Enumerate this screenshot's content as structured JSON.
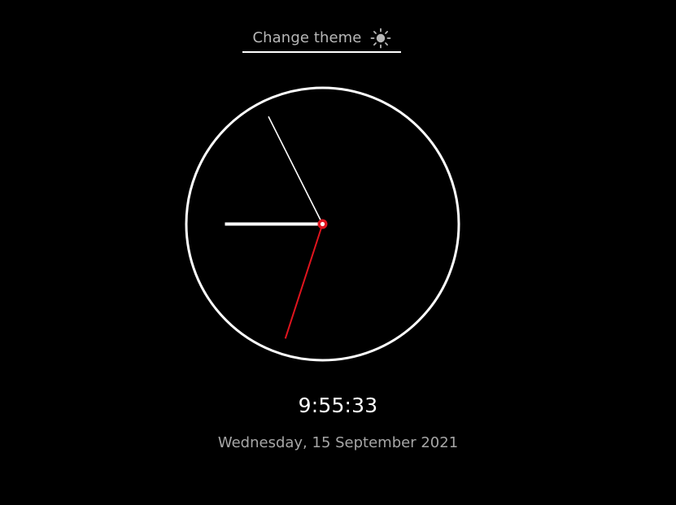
{
  "theme_toggle": {
    "label": "Change theme",
    "icon": "sun-icon"
  },
  "clock": {
    "hours": 9,
    "minutes": 55,
    "seconds": 33,
    "colors": {
      "face_border": "#ffffff",
      "hour_hand": "#ffffff",
      "minute_hand": "#ffffff",
      "second_hand": "#e0141e",
      "center_outer": "#e0141e",
      "center_inner": "#ffffff",
      "background": "#000000"
    }
  },
  "time_display": "9:55:33",
  "date_display": "Wednesday, 15 September 2021"
}
